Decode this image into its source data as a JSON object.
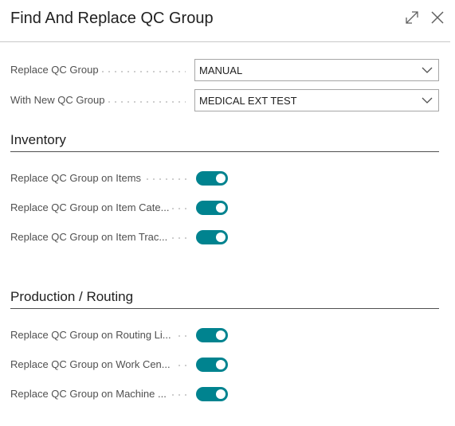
{
  "dialog": {
    "title": "Find And Replace QC Group",
    "icons": {
      "expand": "expand-icon",
      "close": "close-icon"
    }
  },
  "fields": {
    "replace_qc_group": {
      "label": "Replace QC Group",
      "value": "MANUAL"
    },
    "with_new_qc_group": {
      "label": "With New QC Group",
      "value": "MEDICAL EXT TEST"
    }
  },
  "inventory": {
    "title": "Inventory",
    "toggles": [
      {
        "label": "Replace QC Group on Items",
        "on": true
      },
      {
        "label": "Replace QC Group on Item Cate...",
        "on": true
      },
      {
        "label": "Replace QC Group on Item Trac...",
        "on": true
      }
    ]
  },
  "production": {
    "title": "Production / Routing",
    "toggles": [
      {
        "label": "Replace QC Group on Routing Li...",
        "on": true
      },
      {
        "label": "Replace QC Group on Work Cen...",
        "on": true
      },
      {
        "label": "Replace QC Group on Machine ...",
        "on": true
      }
    ]
  },
  "colors": {
    "accent": "#00838f",
    "text": "#212121",
    "label": "#505050",
    "border": "#a6a6a6"
  }
}
